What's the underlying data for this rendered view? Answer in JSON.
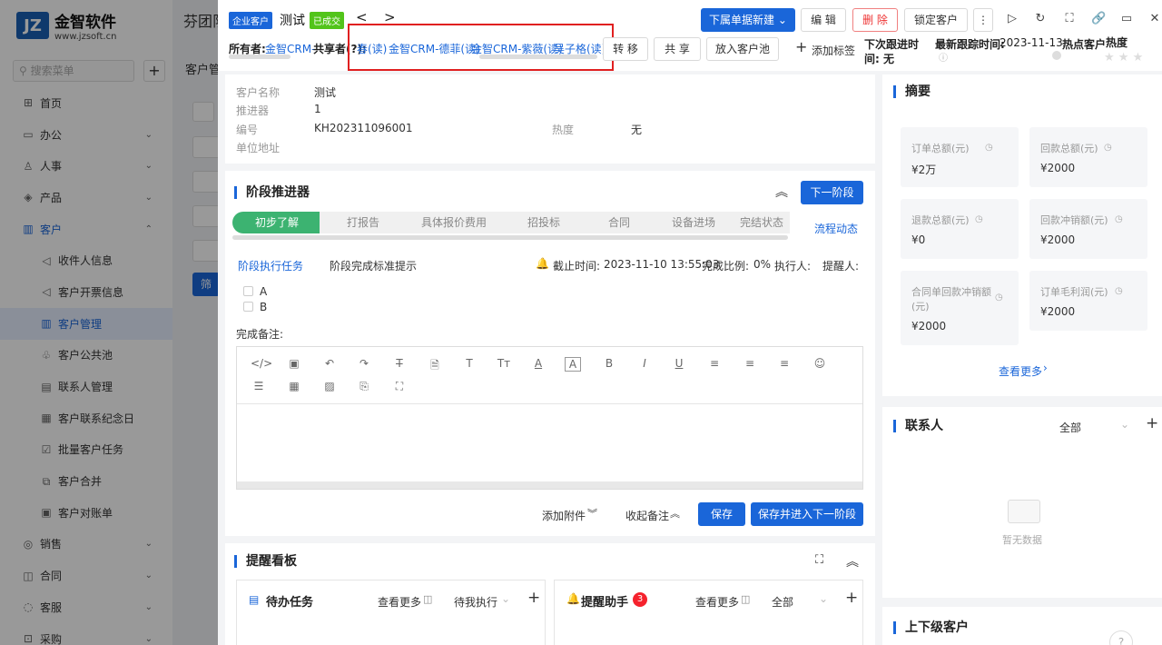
{
  "sidebar": {
    "logo_mark": "JZ",
    "logo_title": "金智软件",
    "logo_sub": "www.jzsoft.cn",
    "search_placeholder": "搜索菜单",
    "items": [
      {
        "icon": "⊞",
        "label": "首页"
      },
      {
        "icon": "▭",
        "label": "办公"
      },
      {
        "icon": "♙",
        "label": "人事"
      },
      {
        "icon": "◈",
        "label": "产品"
      },
      {
        "icon": "▥",
        "label": "客户"
      },
      {
        "icon": "◁",
        "label": "收件人信息"
      },
      {
        "icon": "◁",
        "label": "客户开票信息"
      },
      {
        "icon": "▥",
        "label": "客户管理"
      },
      {
        "icon": "♧",
        "label": "客户公共池"
      },
      {
        "icon": "▤",
        "label": "联系人管理"
      },
      {
        "icon": "▦",
        "label": "客户联系纪念日"
      },
      {
        "icon": "☑",
        "label": "批量客户任务"
      },
      {
        "icon": "⧉",
        "label": "客户合并"
      },
      {
        "icon": "▣",
        "label": "客户对账单"
      },
      {
        "icon": "◎",
        "label": "销售"
      },
      {
        "icon": "◫",
        "label": "合同"
      },
      {
        "icon": "◌",
        "label": "客服"
      },
      {
        "icon": "⊡",
        "label": "采购"
      }
    ]
  },
  "background": {
    "tab_title": "芬团队",
    "crumb": "客户管",
    "filter_btn": "筛"
  },
  "header": {
    "type_tag": "企业客户",
    "customer_name": "测试",
    "status_tag": "已成交",
    "prev": "<",
    "next": ">",
    "create_btn": "下属单据新建",
    "edit_btn": "编 辑",
    "delete_btn": "删 除",
    "lock_btn": "锁定客户",
    "owner_label": "所有者:",
    "owner_value": "金智CRM-",
    "share_label": "共享者(?):",
    "sharers": [
      "春(读)",
      "金智CRM-德菲(读)",
      "金智CRM-紫薇(读)",
      "吴子格(读)"
    ],
    "transfer_btn": "转 移",
    "share_btn": "共 享",
    "pool_btn": "放入客户池",
    "add_tag": "添加标签",
    "next_follow_label": "下次跟进时",
    "next_follow_label2": "间: 无",
    "last_follow_label": "最新跟踪时间:",
    "last_follow_value": "2023-11-13",
    "hot_label": "热点客户",
    "heat_label": "热度"
  },
  "info": {
    "rows": [
      {
        "label": "客户名称",
        "value": "测试"
      },
      {
        "label": "推进器",
        "value": "1"
      },
      {
        "label": "编号",
        "value": "KH202311096001"
      },
      {
        "label": "单位地址",
        "value": ""
      }
    ],
    "heat_label": "热度",
    "heat_value": "无"
  },
  "stage": {
    "title": "阶段推进器",
    "next_btn": "下一阶段",
    "flow_link": "流程动态",
    "stages": [
      "初步了解",
      "打报告",
      "具体报价费用",
      "招投标",
      "合同",
      "设备进场",
      "完结状态"
    ],
    "tab_tasks": "阶段执行任务",
    "tab_hint": "阶段完成标准提示",
    "deadline_label": "截止时间:",
    "deadline_value": "2023-11-10 13:55:03",
    "ratio_label": "完成比例:",
    "ratio_value": "0%",
    "executor_label": "执行人:",
    "reminder_label": "提醒人:",
    "tasks": [
      "A",
      "B"
    ],
    "note_label": "完成备注:",
    "attach": "添加附件",
    "collapse_note": "收起备注",
    "save_btn": "保存",
    "save_next_btn": "保存并进入下一阶段"
  },
  "toolbar": {
    "row1": [
      "</>",
      "▣",
      "↶",
      "↷",
      "T̶",
      "🗎",
      "T",
      "Tт",
      "A",
      "A",
      "B",
      "I",
      "U",
      "≡",
      "≡",
      "≡",
      "☺"
    ],
    "row2": [
      "☰",
      "▦",
      "▨",
      "⎘",
      "⛶"
    ]
  },
  "reminder": {
    "title": "提醒看板",
    "todo_title": "待办任务",
    "todo_more": "查看更多",
    "todo_filter": "待我执行",
    "assist_title": "提醒助手",
    "assist_badge": "3",
    "assist_more": "查看更多",
    "assist_filter": "全部"
  },
  "summary": {
    "title": "摘要",
    "cards": [
      {
        "label": "订单总额(元)",
        "value": "¥2万"
      },
      {
        "label": "回款总额(元)",
        "value": "¥2000"
      },
      {
        "label": "退款总额(元)",
        "value": "¥0"
      },
      {
        "label": "回款冲销额(元)",
        "value": "¥2000"
      },
      {
        "label": "合同单回款冲销额(元)",
        "value": "¥2000"
      },
      {
        "label": "订单毛利润(元)",
        "value": "¥2000"
      }
    ],
    "more": "查看更多"
  },
  "contacts": {
    "title": "联系人",
    "filter": "全部",
    "empty": "暂无数据"
  },
  "parent": {
    "title": "上下级客户"
  },
  "colors": {
    "primary": "#1a66d9",
    "danger": "#e33333",
    "highlight_box": "#e02020",
    "status_green": "#52c41a",
    "badge_red": "#f5222d"
  }
}
